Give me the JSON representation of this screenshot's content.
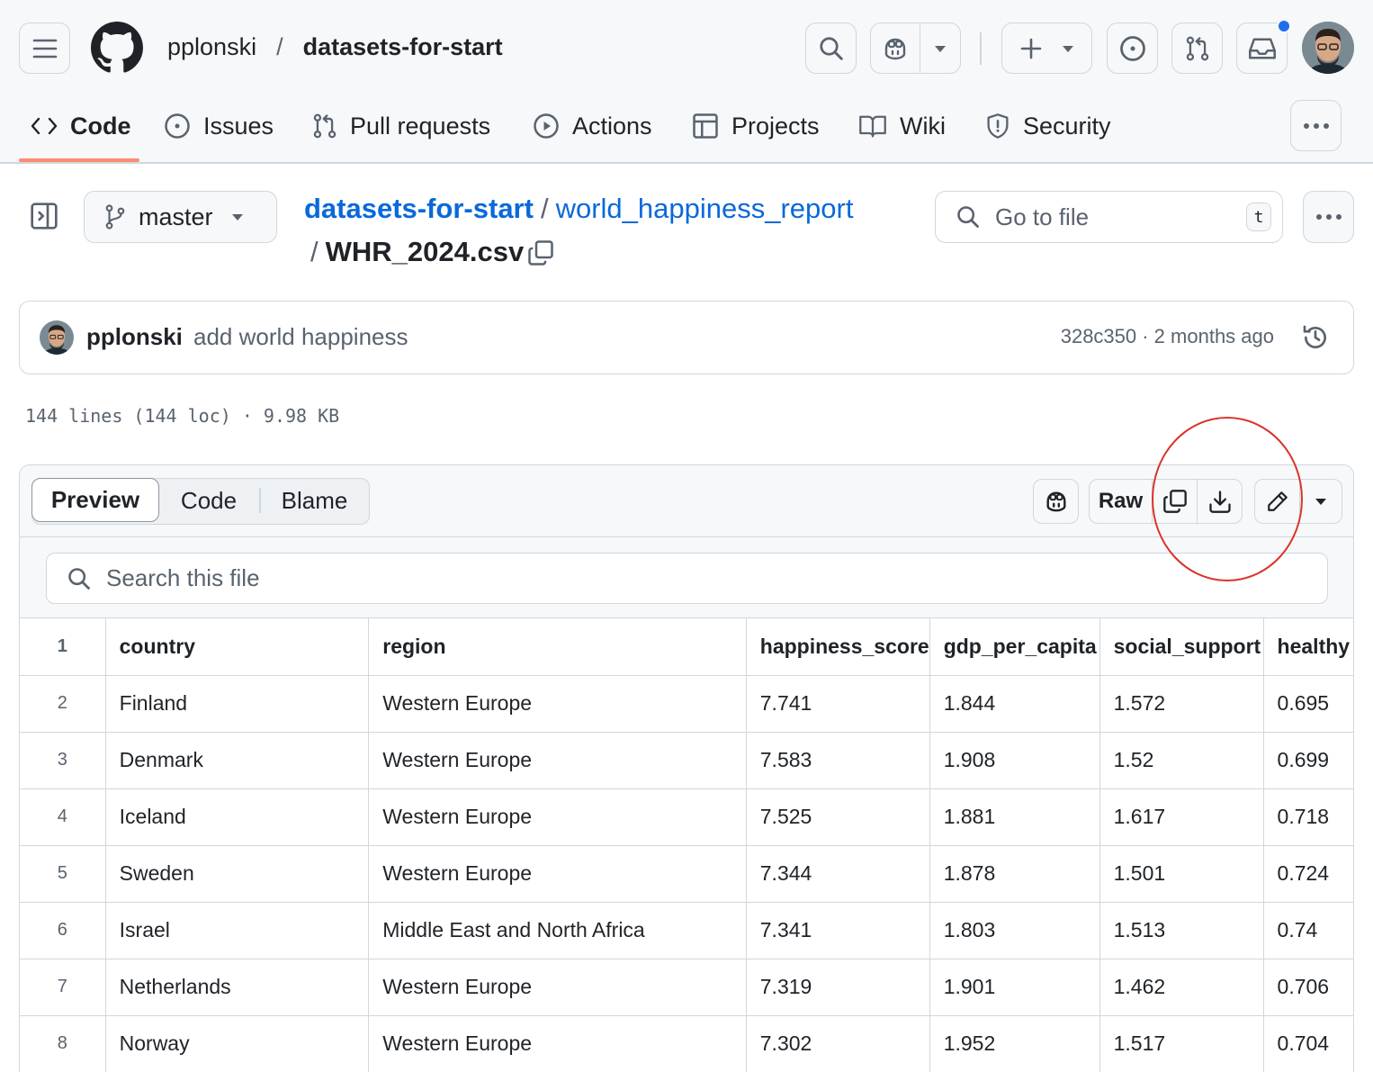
{
  "header": {
    "owner": "pplonski",
    "separator": "/",
    "repo": "datasets-for-start"
  },
  "repo_tabs": [
    {
      "label": "Code",
      "icon": "code-icon",
      "selected": true
    },
    {
      "label": "Issues",
      "icon": "issue-opened-icon"
    },
    {
      "label": "Pull requests",
      "icon": "git-pull-request-icon"
    },
    {
      "label": "Actions",
      "icon": "play-icon"
    },
    {
      "label": "Projects",
      "icon": "table-icon"
    },
    {
      "label": "Wiki",
      "icon": "book-icon"
    },
    {
      "label": "Security",
      "icon": "shield-icon"
    }
  ],
  "branch": {
    "name": "master"
  },
  "path": {
    "repo": "datasets-for-start",
    "sep1": "/",
    "folder": "world_happiness_report",
    "sep2": "/",
    "file": "WHR_2024.csv"
  },
  "go_to_file": {
    "placeholder": "Go to file",
    "shortcut": "t"
  },
  "commit": {
    "author": "pplonski",
    "message": "add world happiness",
    "sha_time": "328c350 · 2 months ago"
  },
  "file_meta": "144 lines (144 loc) · 9.98 KB",
  "view_tabs": [
    {
      "label": "Preview",
      "selected": true
    },
    {
      "label": "Code"
    },
    {
      "label": "Blame"
    }
  ],
  "toolbar": {
    "raw_label": "Raw"
  },
  "search": {
    "placeholder": "Search this file"
  },
  "table": {
    "line_numbers": [
      "1",
      "2",
      "3",
      "4",
      "5",
      "6",
      "7",
      "8"
    ],
    "headers": [
      "country",
      "region",
      "happiness_score",
      "gdp_per_capita",
      "social_support",
      "healthy"
    ],
    "rows": [
      [
        "Finland",
        "Western Europe",
        "7.741",
        "1.844",
        "1.572",
        "0.695"
      ],
      [
        "Denmark",
        "Western Europe",
        "7.583",
        "1.908",
        "1.52",
        "0.699"
      ],
      [
        "Iceland",
        "Western Europe",
        "7.525",
        "1.881",
        "1.617",
        "0.718"
      ],
      [
        "Sweden",
        "Western Europe",
        "7.344",
        "1.878",
        "1.501",
        "0.724"
      ],
      [
        "Israel",
        "Middle East and North Africa",
        "7.341",
        "1.803",
        "1.513",
        "0.74"
      ],
      [
        "Netherlands",
        "Western Europe",
        "7.319",
        "1.901",
        "1.462",
        "0.706"
      ],
      [
        "Norway",
        "Western Europe",
        "7.302",
        "1.952",
        "1.517",
        "0.704"
      ]
    ]
  },
  "colors": {
    "link": "#0969da",
    "selected_tab_underline": "#fd8c73",
    "annotation_circle": "#d9342b",
    "notification_dot": "#1f6feb"
  }
}
